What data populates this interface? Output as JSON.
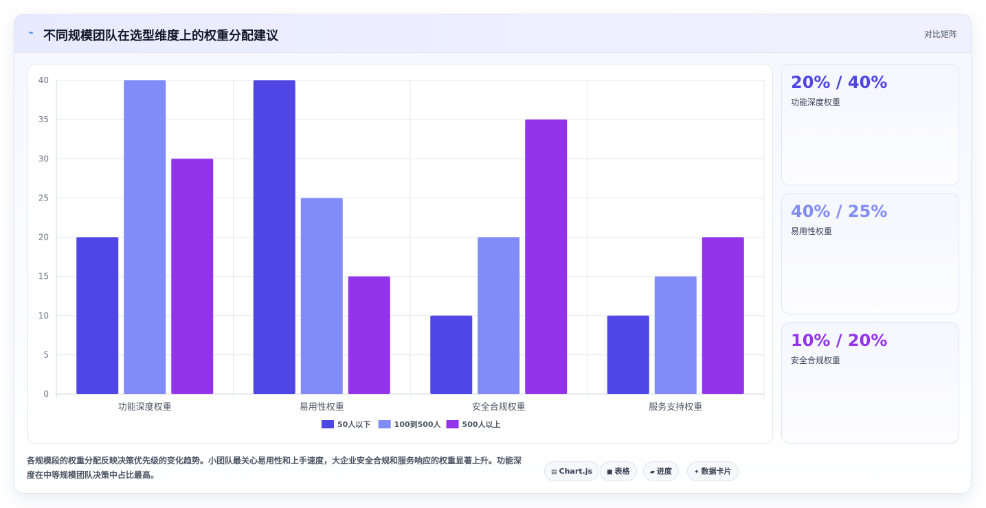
{
  "header": {
    "title": "不同规模团队在选型维度上的权重分配建议",
    "tag": "对比矩阵",
    "icon": "trend-line-icon"
  },
  "chart_data": {
    "type": "bar",
    "categories": [
      "功能深度权重",
      "易用性权重",
      "安全合规权重",
      "服务支持权重"
    ],
    "series": [
      {
        "name": "50人以下",
        "values": [
          20,
          40,
          10,
          10
        ],
        "color": "#4f46e5"
      },
      {
        "name": "100到500人",
        "values": [
          40,
          25,
          20,
          15
        ],
        "color": "#818cf8"
      },
      {
        "name": "500人以上",
        "values": [
          30,
          15,
          35,
          20
        ],
        "color": "#9333ea"
      }
    ],
    "ylim": [
      0,
      40
    ],
    "yticks": [
      0,
      5,
      10,
      15,
      20,
      25,
      30,
      35,
      40
    ],
    "grid": true,
    "legend": "bottom"
  },
  "stats": [
    {
      "value": "20% / 40%",
      "label": "功能深度权重",
      "color": "#4f46e5"
    },
    {
      "value": "40% / 25%",
      "label": "易用性权重",
      "color": "#818cf8"
    },
    {
      "value": "10% / 20%",
      "label": "安全合规权重",
      "color": "#9333ea"
    }
  ],
  "note": "各规模段的权重分配反映决策优先级的变化趋势。小团队最关心易用性和上手速度，大企业安全合规和服务响应的权重显著上升。功能深度在中等规模团队决策中占比最高。",
  "pills": [
    {
      "label": "Chart.js",
      "icon": "chart-icon"
    },
    {
      "label": "表格",
      "icon": "table-icon"
    },
    {
      "label": "进度",
      "icon": "progress-icon"
    },
    {
      "label": "数据卡片",
      "icon": "sparkle-icon"
    }
  ]
}
